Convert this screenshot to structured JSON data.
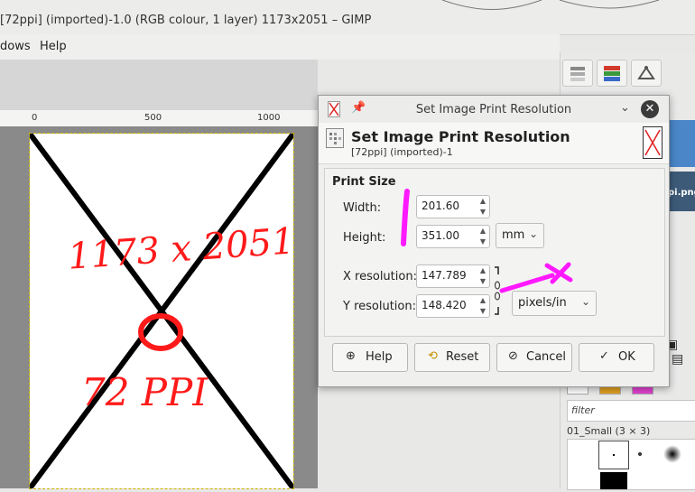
{
  "window": {
    "title": "[72ppi] (imported)-1.0 (RGB colour, 1 layer) 1173x2051 – GIMP"
  },
  "menu": {
    "items": [
      "dows",
      "Help"
    ]
  },
  "ruler": {
    "labels": [
      "0",
      "500",
      "1000"
    ]
  },
  "dock": {
    "layer_name_fragment": "pi.png",
    "filter_placeholder": "filter",
    "brush_set_label": "01_Small (3 × 3)"
  },
  "dialog": {
    "window_title": "Set Image Print Resolution",
    "heading": "Set Image Print Resolution",
    "subheading": "[72ppi] (imported)-1",
    "section_title": "Print Size",
    "width_label": "Width:",
    "width_value": "201.60",
    "height_label": "Height:",
    "height_value": "351.00",
    "size_unit": "mm",
    "xres_label": "X resolution:",
    "xres_value": "147.789",
    "yres_label": "Y resolution:",
    "yres_value": "148.420",
    "res_unit": "pixels/in",
    "buttons": {
      "help": "Help",
      "reset": "Reset",
      "cancel": "Cancel",
      "ok": "OK"
    }
  },
  "annotations": {
    "canvas_text_top": "1173 x 2051",
    "canvas_text_bottom": "72 PPI",
    "colors": {
      "red": "#ff1a1a",
      "magenta": "#ff19ff"
    }
  }
}
